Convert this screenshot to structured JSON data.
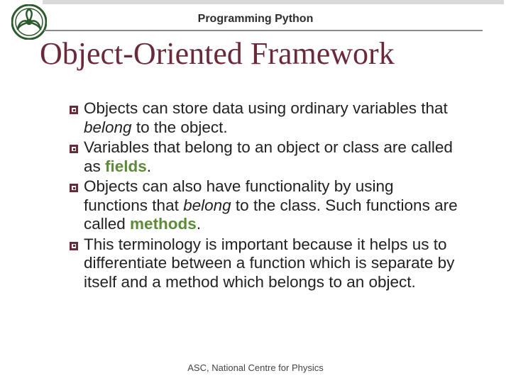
{
  "header": {
    "course": "Programming Python"
  },
  "title": "Object-Oriented Framework",
  "bullets": {
    "b0": "Objects can store data using ordinary variables that <i>belong</i> to the object.",
    "b1": "Variables that belong to an object or class are called as <b class=\"green\">fields</b>.",
    "b2": "Objects can also have functionality by using functions that <i>belong</i> to the class. Such functions are called <b class=\"green\">methods</b>.",
    "b3": "This terminology is important because it helps us to differentiate between a function which is separate by itself and a method which belongs to an object."
  },
  "footer": "ASC, National Centre for Physics"
}
